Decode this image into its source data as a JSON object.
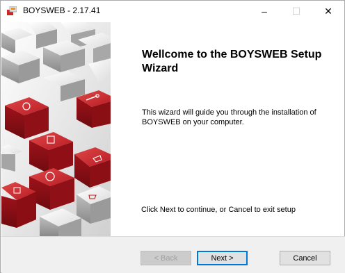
{
  "window": {
    "title": "BOYSWEB - 2.17.41",
    "app_icon": "installer-icon",
    "controls": {
      "minimize": "–",
      "maximize": "☐",
      "close": "✕"
    }
  },
  "wizard": {
    "heading": "Wellcome to the BOYSWEB Setup Wizard",
    "description": "This wizard will guide you through the installation of BOYSWEB on your computer.",
    "hint": "Click Next to continue, or Cancel to exit setup"
  },
  "buttons": {
    "back": "< Back",
    "next": "Next >",
    "cancel": "Cancel"
  },
  "colors": {
    "accent_red": "#c0202a",
    "focus_blue": "#0078d7"
  }
}
